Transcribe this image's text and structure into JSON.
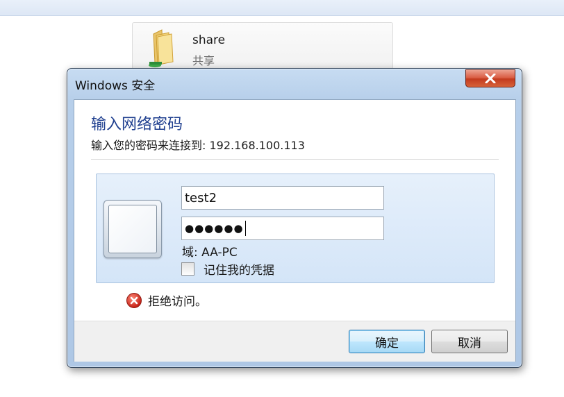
{
  "explorer": {
    "share_name": "share",
    "share_subtitle": "共享"
  },
  "dialog": {
    "title": "Windows 安全",
    "close_icon": "close-x",
    "instruction": "输入网络密码",
    "subtext": "输入您的密码来连接到: 192.168.100.113",
    "username_value": "test2",
    "password_masked": "●●●●●●",
    "domain_text": "域: AA-PC",
    "remember_label": "记住我的凭据",
    "remember_checked": false,
    "error_text": "拒绝访问。",
    "ok_label": "确定",
    "cancel_label": "取消"
  },
  "colors": {
    "instruction": "#1f3f8f",
    "close_button": "#c94a2c",
    "ok_button_border": "#3c7fb1"
  }
}
